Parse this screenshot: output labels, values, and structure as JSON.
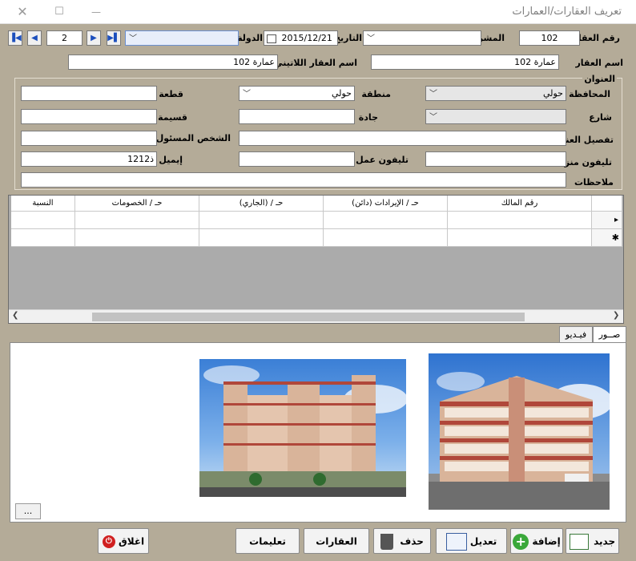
{
  "window": {
    "title": "تعريف العقارات/العمارات",
    "close_glyph": "✕",
    "maximize_glyph": "☐",
    "minimize_glyph": "—"
  },
  "toolbar": {
    "property_no_label": "رقم العقار",
    "property_no": "102",
    "project_label": "المشروع",
    "project_value": "",
    "date_label": "التاريخ",
    "date_value": "2015/12/21",
    "country_label": "الدولة",
    "country_value": "",
    "record_no": "2"
  },
  "names": {
    "property_name_label": "اسم العقار",
    "property_name": "عمارة 102",
    "latin_name_label": "اسم العقار اللاتيني",
    "latin_name": "عمارة 102"
  },
  "address": {
    "group_title": "العنوان",
    "governorate_label": "المحافظة",
    "governorate_value": "حولي",
    "area_label": "منطقة",
    "area_value": "حولي",
    "block_label": "قطعة",
    "block_value": "",
    "street_label": "شارع",
    "street_value": "",
    "avenue_label": "جادة",
    "avenue_value": "",
    "plot_label": "قسيمة",
    "plot_value": "",
    "address_detail_label": "تفصيل العنوان",
    "address_detail_value": "",
    "responsible_label": "الشخص المسئول",
    "responsible_value": "",
    "home_phone_label": "تليفون منزل",
    "home_phone_value": "",
    "work_phone_label": "تليفون عمل",
    "work_phone_value": "",
    "email_label": "إيميل",
    "email_value": "ذ1212",
    "notes_label": "ملاحظات",
    "notes_value": ""
  },
  "grid": {
    "columns": [
      "رقم المالك",
      "حـ / الإيرادات (دائن)",
      "حـ / (الجاري)",
      "حـ / الخصومات",
      "النسبة"
    ],
    "current_row_marker": "▸",
    "new_row_marker": "✱"
  },
  "media_tabs": {
    "photos_label": "صــور",
    "video_label": "فيـديو",
    "more_button": "..."
  },
  "bottom_buttons": {
    "new": "جديد",
    "add": "إضافة",
    "edit": "تعديل",
    "delete": "حذف",
    "properties": "العقارات",
    "help": "تعليمات",
    "close": "اغلاق"
  },
  "colors": {
    "frame": "#b4ab98",
    "nav_arrow": "#1c4fbd",
    "close_icon": "#d02020",
    "add_icon": "#3aa83a"
  }
}
